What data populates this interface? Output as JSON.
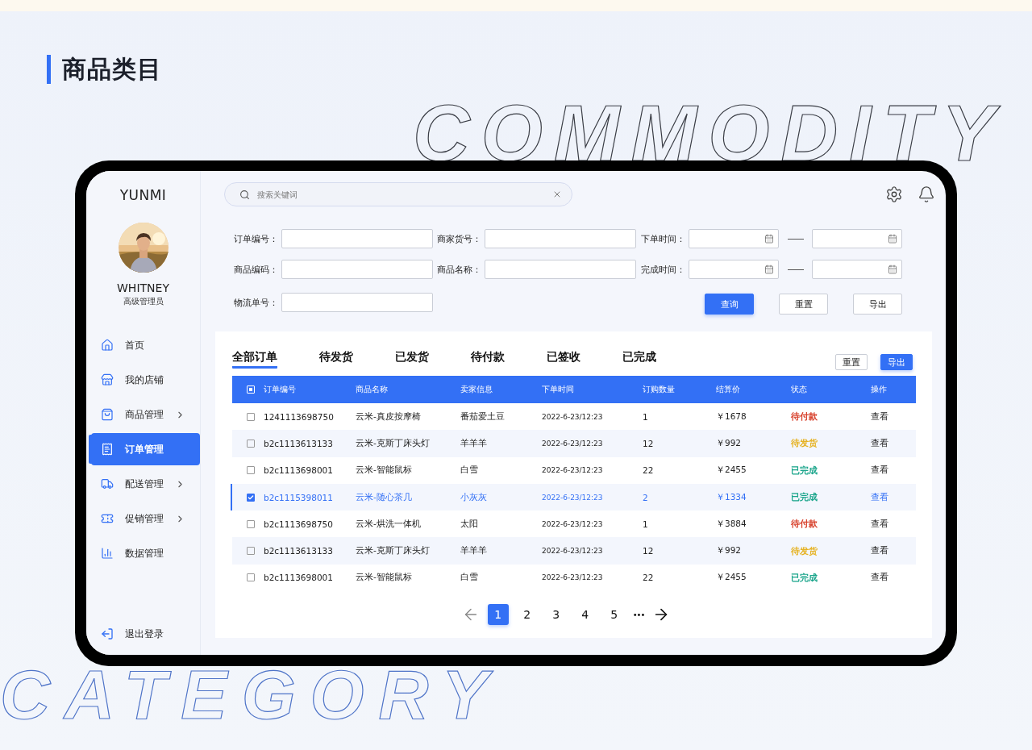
{
  "heading": "商品类目",
  "background_words": {
    "top": "COMMODITY",
    "bottom": "CATEGORY"
  },
  "sidebar": {
    "brand": "YUNMI",
    "user": {
      "name": "WHITNEY",
      "role": "高级管理员"
    },
    "items": [
      {
        "label": "首页",
        "has_submenu": false,
        "selected": false
      },
      {
        "label": "我的店铺",
        "has_submenu": false,
        "selected": false
      },
      {
        "label": "商品管理",
        "has_submenu": true,
        "selected": false
      },
      {
        "label": "订单管理",
        "has_submenu": false,
        "selected": true
      },
      {
        "label": "配送管理",
        "has_submenu": true,
        "selected": false
      },
      {
        "label": "促销管理",
        "has_submenu": true,
        "selected": false
      },
      {
        "label": "数据管理",
        "has_submenu": false,
        "selected": false
      }
    ],
    "logout": "退出登录"
  },
  "topbar": {
    "search": {
      "placeholder": "搜索关键词"
    }
  },
  "filters": {
    "fields": [
      {
        "label": "订单编号：",
        "kind": "text"
      },
      {
        "label": "商家货号：",
        "kind": "text"
      },
      {
        "label": "下单时间：",
        "kind": "date_range"
      },
      {
        "label": "商品编码：",
        "kind": "text"
      },
      {
        "label": "商品名称：",
        "kind": "text"
      },
      {
        "label": "完成时间：",
        "kind": "date_range"
      },
      {
        "label": "物流单号：",
        "kind": "text"
      }
    ],
    "buttons": [
      {
        "label": "查询",
        "kind": "primary"
      },
      {
        "label": "重置",
        "kind": "default"
      },
      {
        "label": "导出",
        "kind": "default"
      }
    ]
  },
  "orders": {
    "tabs": [
      {
        "label": "全部订单",
        "selected": true
      },
      {
        "label": "待发货",
        "selected": false
      },
      {
        "label": "已发货",
        "selected": false
      },
      {
        "label": "待付款",
        "selected": false
      },
      {
        "label": "已签收",
        "selected": false
      },
      {
        "label": "已完成",
        "selected": false
      }
    ],
    "buttons": [
      {
        "label": "重置",
        "kind": "default"
      },
      {
        "label": "导出",
        "kind": "primary"
      }
    ],
    "table": {
      "select_all": {
        "indeterminate": true
      },
      "columns": [
        "订单编号",
        "商品名称",
        "卖家信息",
        "下单时间",
        "订购数量",
        "结算价",
        "状态",
        "操作"
      ],
      "rows": [
        {
          "checked": false,
          "selected": false,
          "cells": [
            "1241113698750",
            "云米-真皮按摩椅",
            "番茄爱土豆",
            "2022-6-23/12:23",
            "1",
            "￥1678"
          ],
          "status": {
            "text": "待付款",
            "color": "#d8432e"
          },
          "action": "查看"
        },
        {
          "checked": false,
          "selected": false,
          "cells": [
            "b2c1113613133",
            "云米-克斯丁床头灯",
            "羊羊羊",
            "2022-6-23/12:23",
            "12",
            "￥992"
          ],
          "status": {
            "text": "待发货",
            "color": "#e6b325"
          },
          "action": "查看"
        },
        {
          "checked": false,
          "selected": false,
          "cells": [
            "b2c1113698001",
            "云米-智能鼠标",
            "白雪",
            "2022-6-23/12:23",
            "22",
            "￥2455"
          ],
          "status": {
            "text": "已完成",
            "color": "#1ba58b"
          },
          "action": "查看"
        },
        {
          "checked": true,
          "selected": true,
          "cells": [
            "b2c1115398011",
            "云米-随心茶几",
            "小灰灰",
            "2022-6-23/12:23",
            "2",
            "￥1334"
          ],
          "status": {
            "text": "已完成",
            "color": "#1ba58b"
          },
          "action": "查看"
        },
        {
          "checked": false,
          "selected": false,
          "cells": [
            "b2c1113698750",
            "云米-烘洗一体机",
            "太阳",
            "2022-6-23/12:23",
            "1",
            "￥3884"
          ],
          "status": {
            "text": "待付款",
            "color": "#d8432e"
          },
          "action": "查看"
        },
        {
          "checked": false,
          "selected": false,
          "cells": [
            "b2c1113613133",
            "云米-克斯丁床头灯",
            "羊羊羊",
            "2022-6-23/12:23",
            "12",
            "￥992"
          ],
          "status": {
            "text": "待发货",
            "color": "#e6b325"
          },
          "action": "查看"
        },
        {
          "checked": false,
          "selected": false,
          "cells": [
            "b2c1113698001",
            "云米-智能鼠标",
            "白雪",
            "2022-6-23/12:23",
            "22",
            "￥2455"
          ],
          "status": {
            "text": "已完成",
            "color": "#1ba58b"
          },
          "action": "查看"
        }
      ]
    },
    "pagination": {
      "pages": [
        {
          "label": "1",
          "selected": true
        },
        {
          "label": "2",
          "selected": false
        },
        {
          "label": "3",
          "selected": false
        },
        {
          "label": "4",
          "selected": false
        },
        {
          "label": "5",
          "selected": false
        }
      ],
      "ellipsis": "•••"
    }
  }
}
